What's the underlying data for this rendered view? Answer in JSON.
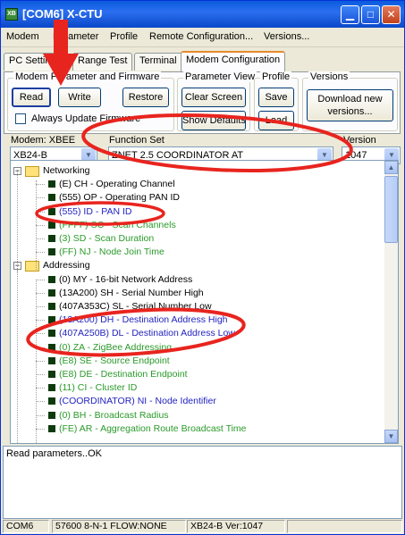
{
  "window": {
    "title": "[COM6] X-CTU",
    "icon_label": "XB"
  },
  "title_buttons": {
    "minimize_icon": "minimize-icon",
    "maximize_icon": "maximize-icon",
    "close_icon": "close-icon"
  },
  "menu": [
    "Modem",
    "Parameter",
    "Profile",
    "Remote Configuration...",
    "Versions..."
  ],
  "tabs": [
    "PC Settings",
    "Range Test",
    "Terminal",
    "Modem Configuration"
  ],
  "groups": {
    "modem_param": {
      "title": "Modem Parameter and Firmware",
      "read": "Read",
      "write": "Write",
      "restore": "Restore",
      "always_update": "Always Update Firmware"
    },
    "param_view": {
      "title": "Parameter View",
      "clear": "Clear Screen",
      "defaults": "Show Defaults"
    },
    "profile": {
      "title": "Profile",
      "save": "Save",
      "load": "Load"
    },
    "versions": {
      "title": "Versions",
      "download": "Download new versions..."
    }
  },
  "modem": {
    "label": "Modem: XBEE",
    "value": "XB24-B"
  },
  "function_set": {
    "label": "Function Set",
    "value": "ZNET 2.5 COORDINATOR AT"
  },
  "version": {
    "label": "Version",
    "value": "1047"
  },
  "tree": [
    {
      "type": "folder",
      "text": "Networking"
    },
    {
      "type": "param",
      "color": "black",
      "text": "(E) CH - Operating Channel"
    },
    {
      "type": "param",
      "color": "black",
      "text": "(555) OP - Operating PAN ID"
    },
    {
      "type": "param",
      "color": "blue",
      "text": "(555) ID - PAN ID"
    },
    {
      "type": "param",
      "color": "green",
      "text": "(FFFF) SC - Scan Channels"
    },
    {
      "type": "param",
      "color": "green",
      "text": "(3) SD - Scan Duration"
    },
    {
      "type": "param",
      "color": "green",
      "text": "(FF) NJ - Node Join Time"
    },
    {
      "type": "folder",
      "text": "Addressing"
    },
    {
      "type": "param",
      "color": "black",
      "text": "(0) MY - 16-bit Network Address"
    },
    {
      "type": "param",
      "color": "black",
      "text": "(13A200) SH - Serial Number High"
    },
    {
      "type": "param",
      "color": "black",
      "text": "(407A353C) SL - Serial Number Low"
    },
    {
      "type": "param",
      "color": "blue",
      "text": "(13A200) DH - Destination Address High"
    },
    {
      "type": "param",
      "color": "blue",
      "text": "(407A250B) DL - Destination Address Low"
    },
    {
      "type": "param",
      "color": "green",
      "text": "(0) ZA - ZigBee Addressing"
    },
    {
      "type": "param",
      "color": "green",
      "text": "(E8) SE - Source Endpoint"
    },
    {
      "type": "param",
      "color": "green",
      "text": "(E8) DE - Destination Endpoint"
    },
    {
      "type": "param",
      "color": "green",
      "text": "(11) CI - Cluster ID"
    },
    {
      "type": "param",
      "color": "blue",
      "text": "(COORDINATOR) NI - Node Identifier"
    },
    {
      "type": "param",
      "color": "green",
      "text": "(0) BH - Broadcast Radius"
    },
    {
      "type": "param",
      "color": "green",
      "text": "(FE) AR - Aggregation Route Broadcast Time"
    }
  ],
  "log": {
    "text": "Read parameters..OK"
  },
  "status": {
    "port": "COM6",
    "settings": "57600 8-N-1  FLOW:NONE",
    "modem": "XB24-B  Ver:1047"
  },
  "colors": {
    "annotation_red": "#e8241e",
    "title_blue": "#0a5bdc"
  }
}
